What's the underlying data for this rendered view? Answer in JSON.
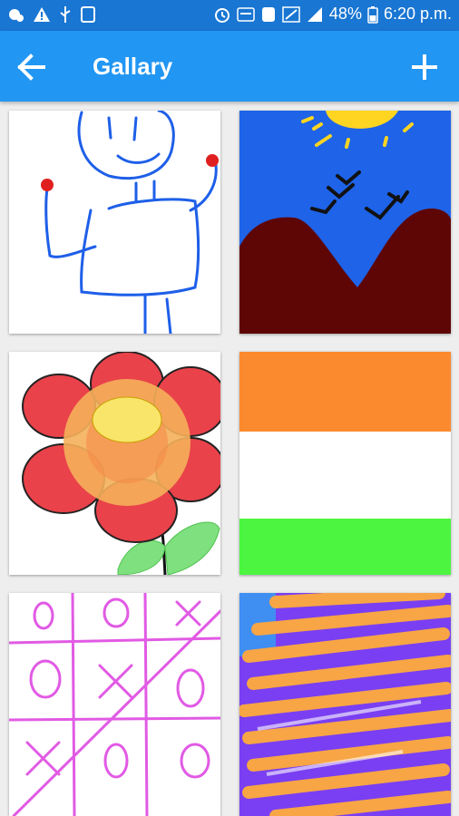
{
  "status_bar": {
    "battery": "48%",
    "time": "6:20 p.m."
  },
  "app_bar": {
    "title": "Gallary"
  },
  "gallery": {
    "items": [
      {
        "name": "stick-figure-drawing"
      },
      {
        "name": "mountains-sun-drawing"
      },
      {
        "name": "flower-drawing"
      },
      {
        "name": "flag-drawing"
      },
      {
        "name": "tic-tac-toe-drawing"
      },
      {
        "name": "scribble-drawing"
      }
    ]
  },
  "colors": {
    "status_bar": "#1976d2",
    "app_bar": "#2196f3"
  }
}
